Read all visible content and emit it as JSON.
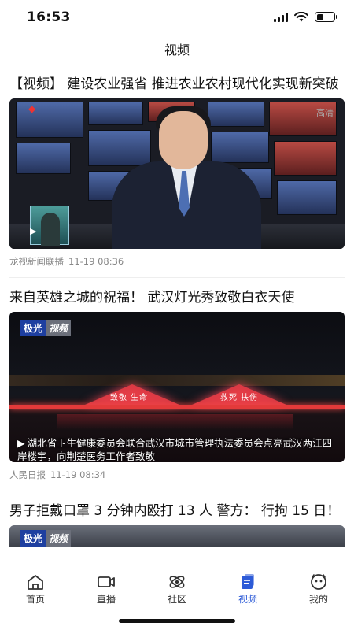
{
  "status": {
    "time": "16:53",
    "battery_level": 0.4
  },
  "nav": {
    "title": "视频"
  },
  "articles": [
    {
      "title": "【视频】 建设农业强省 推进农业农村现代化实现新突破",
      "source": "龙视新闻联播",
      "time": "11-19 08:36",
      "corner_text": "高清"
    },
    {
      "title": "来自英雄之城的祝福！ 武汉灯光秀致敬白衣天使",
      "source": "人民日报",
      "time": "11-19 08:34",
      "brand_a": "极光",
      "brand_b": "视频",
      "bridge_text_1": "致敬 生命",
      "bridge_text_2": "救死 扶伤",
      "caption": "湖北省卫生健康委员会联合武汉市城市管理执法委员会点亮武汉两江四岸楼宇，向荆楚医务工作者致敬"
    },
    {
      "title": "男子拒戴口罩 3 分钟内殴打 13 人 警方： 行拘 15 日！",
      "brand_a": "极光",
      "brand_b": "视频"
    }
  ],
  "tabs": [
    {
      "label": "首页",
      "icon": "home-icon"
    },
    {
      "label": "直播",
      "icon": "live-camera-icon"
    },
    {
      "label": "社区",
      "icon": "community-icon"
    },
    {
      "label": "视频",
      "icon": "video-icon",
      "active": true
    },
    {
      "label": "我的",
      "icon": "profile-icon"
    }
  ],
  "colors": {
    "accent": "#2d5bd7",
    "text": "#111111",
    "meta": "#888888"
  }
}
